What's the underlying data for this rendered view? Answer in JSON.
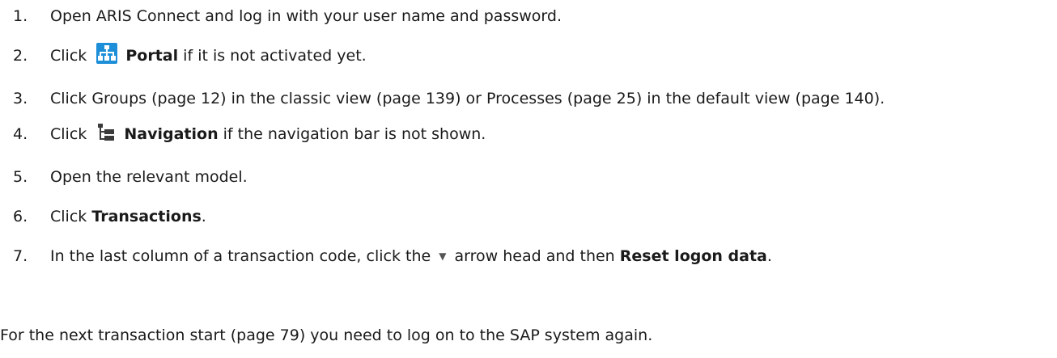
{
  "steps": [
    {
      "num": "1.",
      "text": "Open ARIS Connect and log in with your user name and password."
    },
    {
      "num": "2.",
      "pre": "Click",
      "icon": "portal-icon",
      "bold": "Portal",
      "post": " if it is not activated yet."
    },
    {
      "num": "3.",
      "text": "Click Groups (page 12) in the classic view (page 139) or Processes (page 25) in the default view (page 140)."
    },
    {
      "num": "4.",
      "pre": "Click",
      "icon": "navigation-tree-icon",
      "bold": "Navigation",
      "post": " if the navigation bar is not shown."
    },
    {
      "num": "5.",
      "text": "Open the relevant model."
    },
    {
      "num": "6.",
      "pre": "Click ",
      "bold": "Transactions",
      "post": "."
    },
    {
      "num": "7.",
      "pre": "In the last column of a transaction code, click the",
      "icon": "arrow-head-icon",
      "mid": "arrow head and then ",
      "bold": "Reset logon data",
      "post": "."
    }
  ],
  "note": "For the next transaction start (page 79) you need to log on to the SAP system again."
}
